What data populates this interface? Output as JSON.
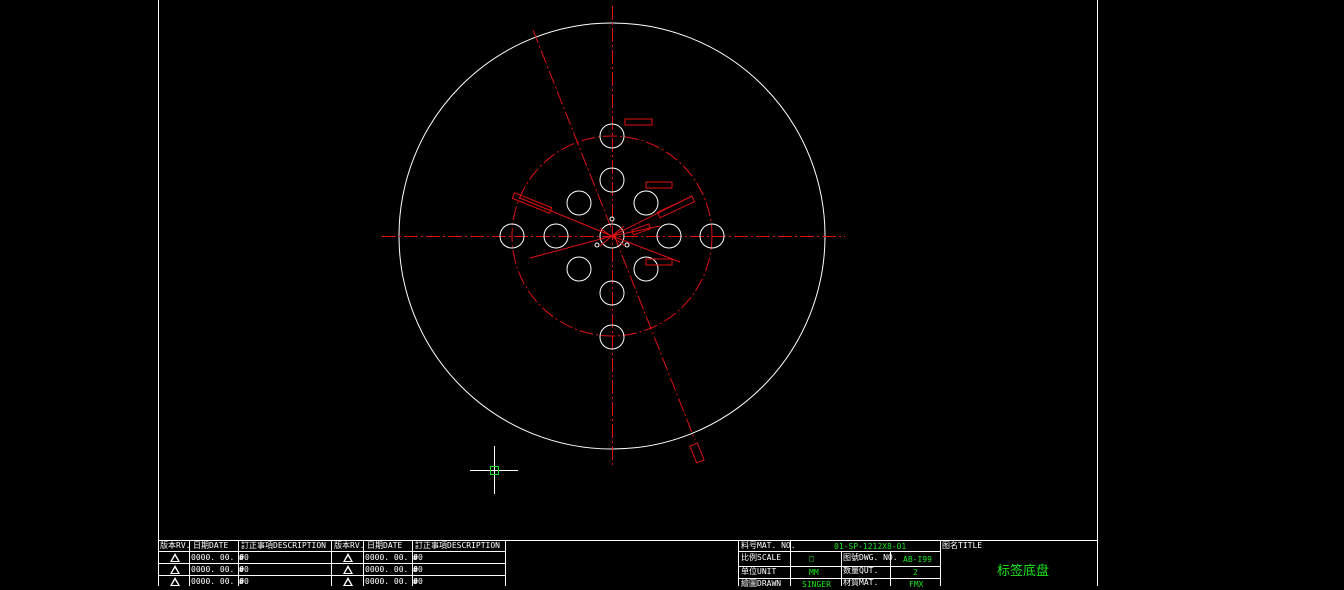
{
  "colors": {
    "background": "#000000",
    "frame": "#ffffff",
    "centerline": "#e01010",
    "value_text": "#19e619"
  },
  "revision_table": {
    "headers": [
      "版本RV.",
      "日期DATE",
      "訂正事項DESCRIPTION",
      "版本RV.",
      "日期DATE",
      "訂正事項DESCRIPTION"
    ],
    "rows": [
      {
        "date_left": "0000. 00. 00",
        "mark_left": "#",
        "date_right": "0000. 00. 00",
        "mark_right": "#"
      },
      {
        "date_left": "0000. 00. 00",
        "mark_left": "#",
        "date_right": "0000. 00. 00",
        "mark_right": "#"
      },
      {
        "date_left": "0000. 00. 00",
        "mark_left": "#",
        "date_right": "0000. 00. 00",
        "mark_right": "#"
      }
    ]
  },
  "info_block": {
    "mat_no_label": "料号MAT. NO.",
    "mat_no_value": "01-SP-1212X8-01",
    "scale_label": "比例SCALE",
    "scale_value": "□",
    "dwg_no_label": "图號DWG. NO.",
    "dwg_no_value": "AB-I99",
    "unit_label": "单位UNIT",
    "unit_value": "MM",
    "qty_label": "数量QUT.",
    "qty_value": "2",
    "drawn_label": "繪圖DRAWN",
    "drawn_value": "SINGER",
    "material_label": "材質MAT.",
    "material_value": "FMX",
    "title_label": "图名TITLE",
    "title_value": "标签底盘"
  },
  "icons": {
    "crosshair": "crosshair-cursor-icon",
    "revision_mark": "revision-triangle-icon"
  }
}
